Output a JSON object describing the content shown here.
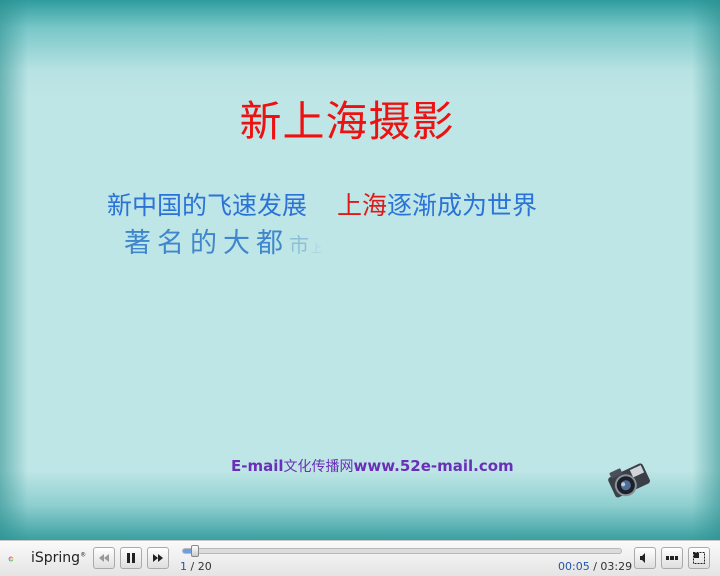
{
  "slide": {
    "title": "新上海摄影",
    "line1_part1": "新中国的飞速发展",
    "line1_red": "上海",
    "line1_part2": "逐渐成为世界",
    "line2_main": "著名的大都",
    "line2_fade1": "市",
    "line2_fade2": "上",
    "email_prefix": "E-mail",
    "email_cn": "文化传播网",
    "email_url": "www.52e-mail.com"
  },
  "player": {
    "logo_text": "iSpring",
    "logo_mark": "®",
    "current_slide": "1",
    "total_slides": "/ 20",
    "time_current": "00:05",
    "time_total": "/ 03:29",
    "progress": 0.025,
    "colors": {
      "progress_fill": "#6e9de0",
      "time_current": "#2255aa"
    }
  }
}
